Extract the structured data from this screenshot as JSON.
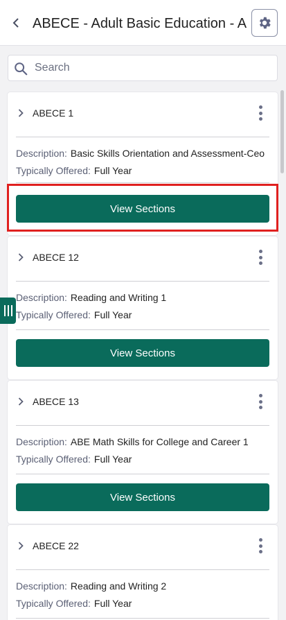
{
  "header": {
    "title": "ABECE - Adult Basic Education - ABECE"
  },
  "search": {
    "placeholder": "Search"
  },
  "courses": [
    {
      "title": "ABECE 1",
      "description_label": "Description:",
      "description": "Basic Skills Orientation and Assessment-Ceo",
      "offered_label": "Typically Offered:",
      "offered": "Full Year",
      "button_label": "View Sections"
    },
    {
      "title": "ABECE 12",
      "description_label": "Description:",
      "description": "Reading and Writing 1",
      "offered_label": "Typically Offered:",
      "offered": "Full Year",
      "button_label": "View Sections"
    },
    {
      "title": "ABECE 13",
      "description_label": "Description:",
      "description": "ABE Math Skills for College and Career 1",
      "offered_label": "Typically Offered:",
      "offered": "Full Year",
      "button_label": "View Sections"
    },
    {
      "title": "ABECE 22",
      "description_label": "Description:",
      "description": "Reading and Writing 2",
      "offered_label": "Typically Offered:",
      "offered": "Full Year"
    }
  ],
  "colors": {
    "accent": "#0a6b5b",
    "highlight": "#e0201f"
  }
}
